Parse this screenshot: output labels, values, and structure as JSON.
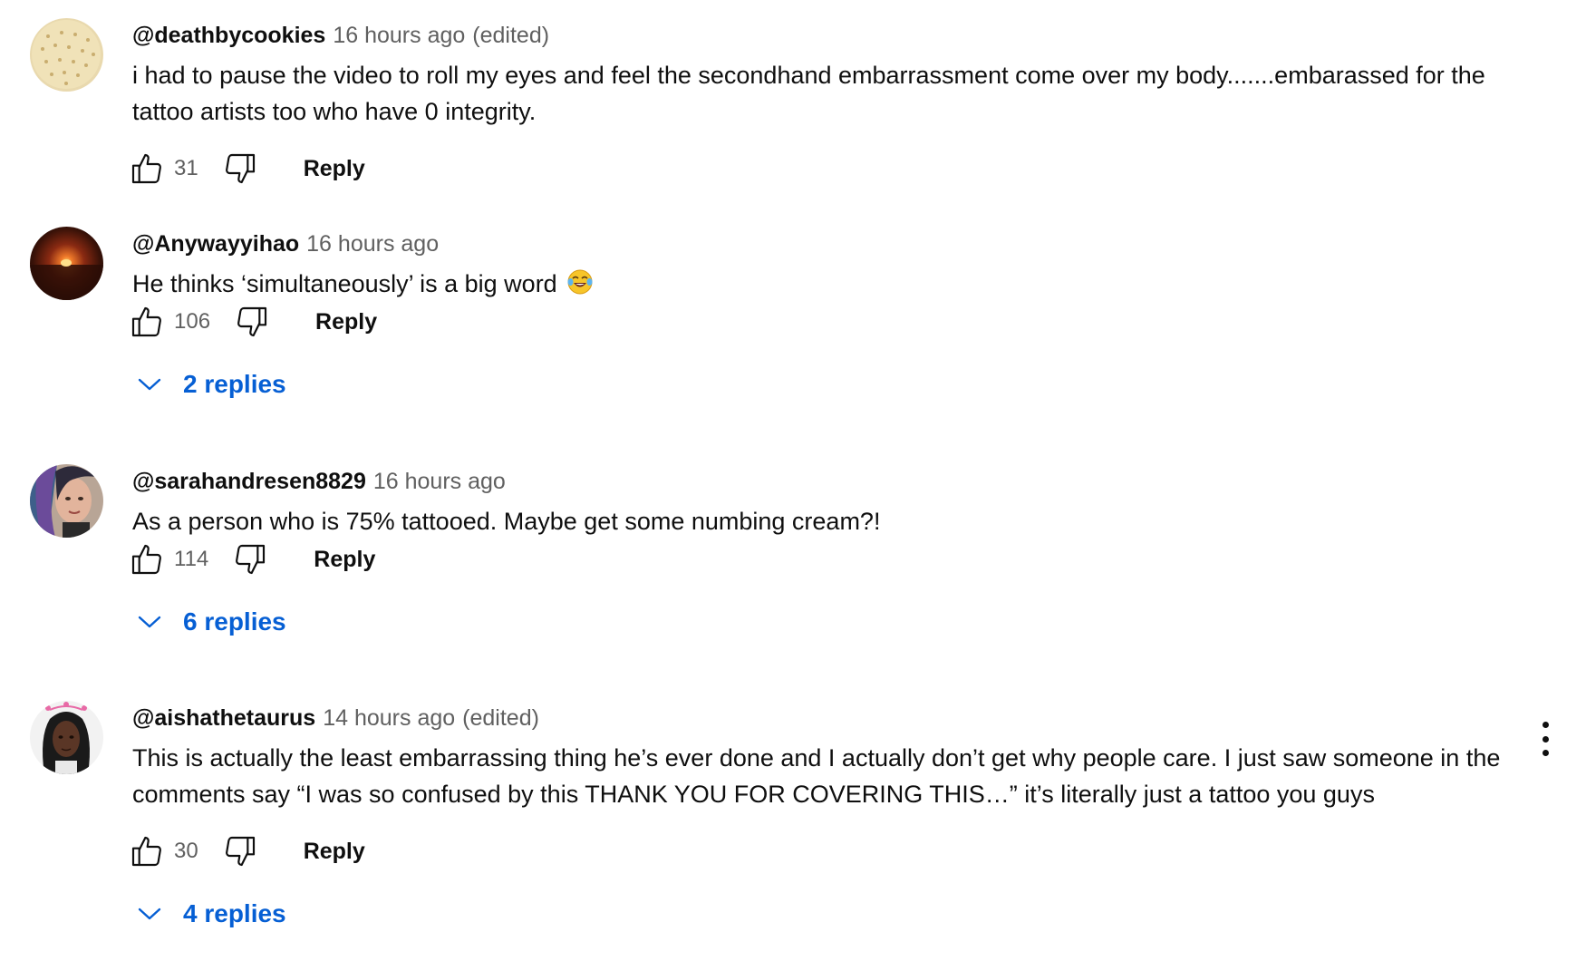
{
  "comments": [
    {
      "author": "@deathbycookies",
      "time": "16 hours ago",
      "edited": "(edited)",
      "text": "i had to pause the video to roll my eyes and feel the secondhand embarrassment come over my body.......embarassed for the tattoo artists too who have 0 integrity.",
      "likes": "31",
      "reply_label": "Reply",
      "replies_label": ""
    },
    {
      "author": "@Anywayyihao",
      "time": "16 hours ago",
      "edited": "",
      "text": "He thinks ‘simultaneously’ is a big word",
      "likes": "106",
      "reply_label": "Reply",
      "replies_label": "2 replies"
    },
    {
      "author": "@sarahandresen8829",
      "time": "16 hours ago",
      "edited": "",
      "text": "As a person who is 75% tattooed. Maybe get some numbing cream?!",
      "likes": "114",
      "reply_label": "Reply",
      "replies_label": "6 replies"
    },
    {
      "author": "@aishathetaurus",
      "time": "14 hours ago",
      "edited": "(edited)",
      "text": "This is actually the least embarrassing thing he’s ever done and I actually don’t get why people care. I just saw someone in the comments say “I was so confused by this THANK YOU FOR COVERING THIS…”  it’s literally just a tattoo you guys",
      "likes": "30",
      "reply_label": "Reply",
      "replies_label": "4 replies"
    }
  ],
  "icons": {
    "like": "thumbs-up-icon",
    "dislike": "thumbs-down-icon",
    "expand": "chevron-down-icon",
    "menu": "more-vert-icon",
    "emoji": "tears-of-joy-emoji"
  },
  "colors": {
    "primary_text": "#0f0f0f",
    "secondary_text": "#606060",
    "link_blue": "#065fd4"
  }
}
